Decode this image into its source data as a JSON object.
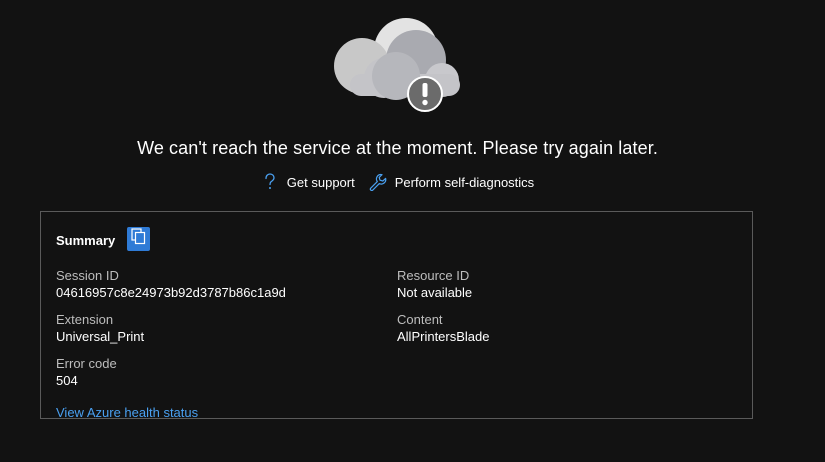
{
  "error": {
    "message": "We can't reach the service at the moment. Please try again later.",
    "icon": "cloud-error-icon"
  },
  "actions": {
    "get_support": {
      "label": "Get support",
      "icon": "question-mark-icon"
    },
    "self_diagnostics": {
      "label": "Perform self-diagnostics",
      "icon": "wrench-icon"
    }
  },
  "summary": {
    "title": "Summary",
    "copy_icon": "copy-icon",
    "session_id": {
      "label": "Session ID",
      "value": "04616957c8e24973b92d3787b86c1a9d"
    },
    "extension": {
      "label": "Extension",
      "value": "Universal_Print"
    },
    "error_code": {
      "label": "Error code",
      "value": "504"
    },
    "resource_id": {
      "label": "Resource ID",
      "value": "Not available"
    },
    "content": {
      "label": "Content",
      "value": "AllPrintersBlade"
    },
    "health_link": "View Azure health status"
  },
  "colors": {
    "background": "#121212",
    "accent": "#2f7bd6",
    "link": "#4aa0f0",
    "border": "#5a5a5a"
  }
}
